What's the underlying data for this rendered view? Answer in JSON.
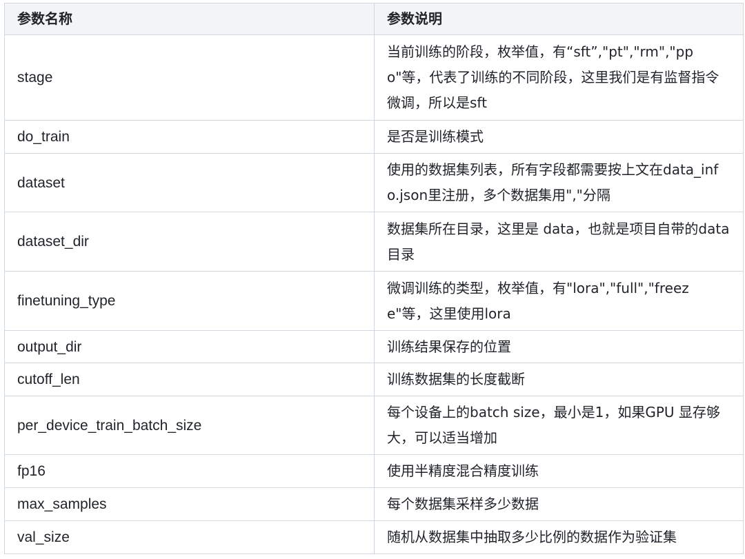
{
  "table": {
    "headers": [
      "参数名称",
      "参数说明"
    ],
    "rows": [
      {
        "name": "stage",
        "desc": "当前训练的阶段，枚举值，有“sft”,\"pt\",\"rm\",\"ppo\"等，代表了训练的不同阶段，这里我们是有监督指令微调，所以是sft"
      },
      {
        "name": "do_train",
        "desc": "是否是训练模式"
      },
      {
        "name": "dataset",
        "desc": "使用的数据集列表，所有字段都需要按上文在data_info.json里注册，多个数据集用\",\"分隔"
      },
      {
        "name": "dataset_dir",
        "desc": "数据集所在目录，这里是 data，也就是项目自带的data目录"
      },
      {
        "name": "finetuning_type",
        "desc": "微调训练的类型，枚举值，有\"lora\",\"full\",\"freeze\"等，这里使用lora"
      },
      {
        "name": "output_dir",
        "desc": "训练结果保存的位置"
      },
      {
        "name": "cutoff_len",
        "desc": "训练数据集的长度截断"
      },
      {
        "name": "per_device_train_batch_size",
        "desc": "每个设备上的batch size，最小是1，如果GPU 显存够大，可以适当增加"
      },
      {
        "name": "fp16",
        "desc": "使用半精度混合精度训练"
      },
      {
        "name": "max_samples",
        "desc": "每个数据集采样多少数据"
      },
      {
        "name": "val_size",
        "desc": "随机从数据集中抽取多少比例的数据作为验证集"
      }
    ]
  }
}
